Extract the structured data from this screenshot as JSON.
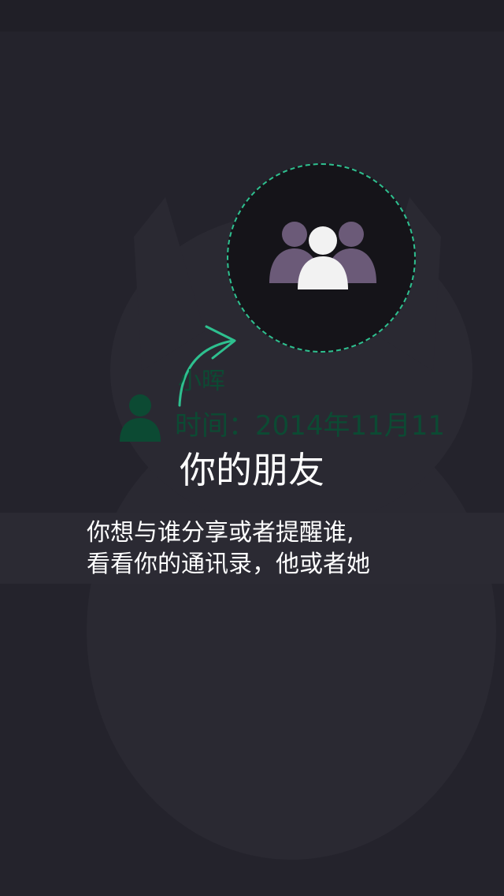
{
  "contact": {
    "name": "小晖",
    "time": "时间：2014年11月11"
  },
  "hero": {
    "icon": "group-users-icon",
    "title": "你的朋友"
  },
  "description": {
    "line1": "你想与谁分享或者提醒谁,",
    "line2": "看看你的通讯录，他或者她"
  },
  "colors": {
    "background": "#24232c",
    "accent": "#2ec08f",
    "contact_text": "#0c4a33",
    "group_side": "#6b5a78",
    "group_center": "#f2f2f2"
  }
}
